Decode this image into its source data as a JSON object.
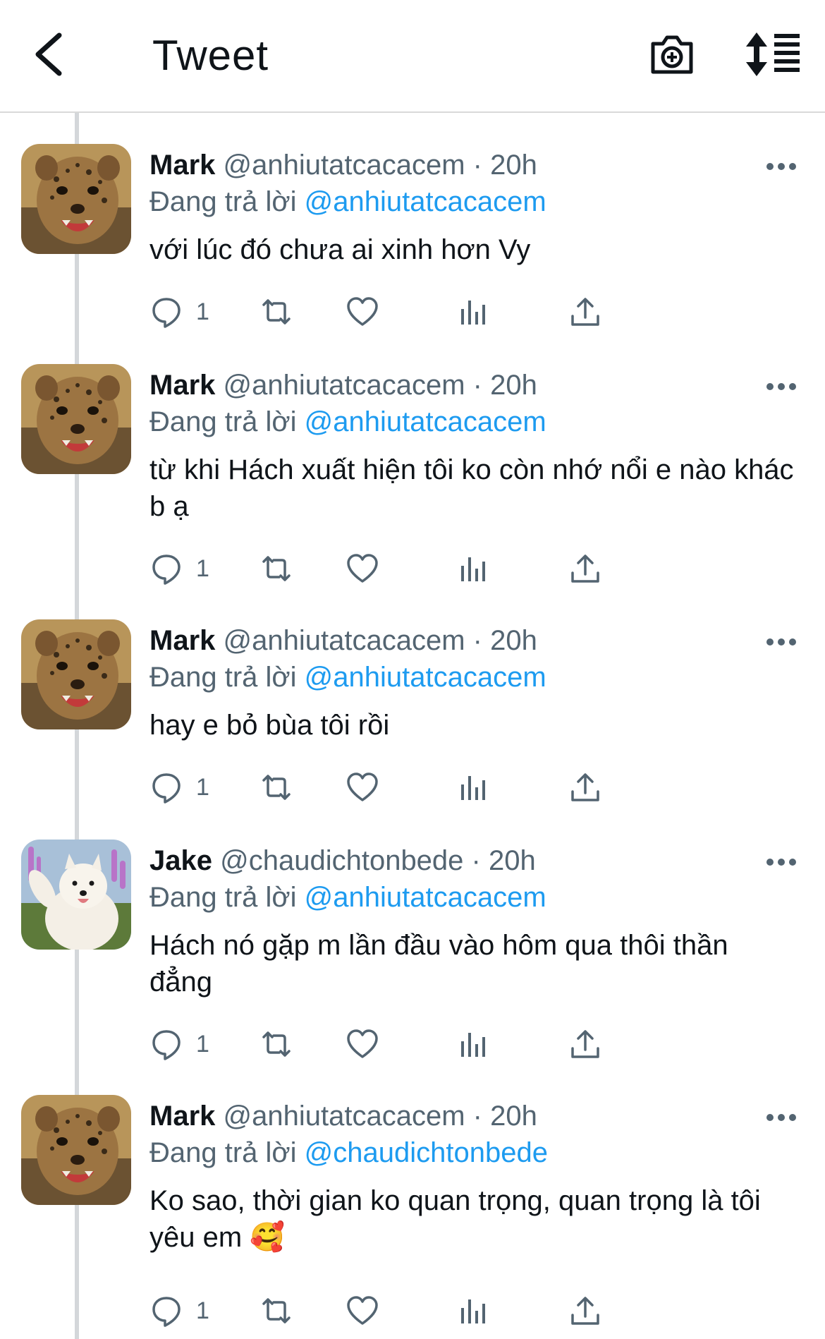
{
  "header": {
    "title": "Tweet",
    "back_icon": "chevron-left-icon",
    "camera_icon": "camera-plus-icon",
    "sort_icon": "sort-list-icon"
  },
  "colors": {
    "link": "#1d9bf0",
    "muted": "#536471",
    "text": "#0f1419"
  },
  "tweets": [
    {
      "name": "Mark",
      "handle": "@anhiutatcacacem",
      "time": "· 20h",
      "replying_label": "Đang trả lời",
      "reply_to": "@anhiutatcacacem",
      "text": "với lúc đó chưa ai xinh hơn Vy",
      "reply_count": "1",
      "avatar": "cheetah-cub"
    },
    {
      "name": "Mark",
      "handle": "@anhiutatcacacem",
      "time": "· 20h",
      "replying_label": "Đang trả lời",
      "reply_to": "@anhiutatcacacem",
      "text": "từ khi Hách xuất hiện tôi ko còn nhớ nổi e nào khác b ạ",
      "reply_count": "1",
      "avatar": "cheetah-cub"
    },
    {
      "name": "Mark",
      "handle": "@anhiutatcacacem",
      "time": "· 20h",
      "replying_label": "Đang trả lời",
      "reply_to": "@anhiutatcacacem",
      "text": "hay e bỏ bùa tôi rồi",
      "reply_count": "1",
      "avatar": "cheetah-cub"
    },
    {
      "name": "Jake",
      "handle": "@chaudichtonbede",
      "time": "· 20h",
      "replying_label": "Đang trả lời",
      "reply_to": "@anhiutatcacacem",
      "text": "Hách nó gặp m lần đầu vào hôm qua thôi thần đẳng",
      "reply_count": "1",
      "avatar": "white-dog"
    },
    {
      "name": "Mark",
      "handle": "@anhiutatcacacem",
      "time": "· 20h",
      "replying_label": "Đang trả lời",
      "reply_to": "@chaudichtonbede",
      "text": "Ko sao, thời gian ko quan trọng, quan trọng là tôi yêu em 🥰",
      "reply_count": "1",
      "avatar": "cheetah-cub"
    }
  ]
}
